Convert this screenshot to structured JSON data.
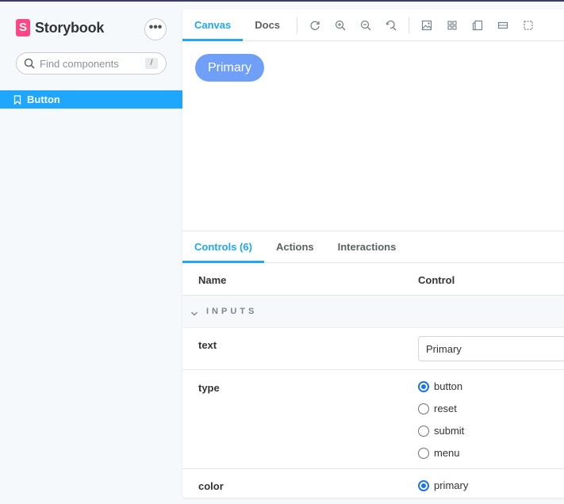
{
  "sidebar": {
    "brand_name": "Storybook",
    "brand_letter": "S",
    "menu_label": "•••",
    "search": {
      "placeholder": "Find components",
      "shortcut": "/"
    },
    "items": [
      {
        "label": "Button",
        "selected": true
      }
    ]
  },
  "toolbar": {
    "tabs": [
      {
        "label": "Canvas",
        "active": true
      },
      {
        "label": "Docs",
        "active": false
      }
    ],
    "tools": [
      "reload-icon",
      "zoom-in-icon",
      "zoom-out-icon",
      "zoom-reset-icon",
      "background-icon",
      "grid-icon",
      "viewport-icon",
      "measure-icon",
      "outline-icon"
    ]
  },
  "canvas": {
    "primary_button_label": "Primary"
  },
  "addons": {
    "tabs": [
      {
        "label": "Controls (6)",
        "active": true
      },
      {
        "label": "Actions",
        "active": false
      },
      {
        "label": "Interactions",
        "active": false
      }
    ],
    "table_headers": {
      "name": "Name",
      "control": "Control"
    },
    "section_label": "INPUTS",
    "rows": {
      "text": {
        "name": "text",
        "value": "Primary"
      },
      "type": {
        "name": "type",
        "options": [
          "button",
          "reset",
          "submit",
          "menu"
        ],
        "selected": "button"
      },
      "color": {
        "name": "color",
        "options": [
          "primary"
        ],
        "selected": "primary"
      }
    }
  },
  "colors": {
    "accent": "#1ea7fd",
    "brand": "#ff4785",
    "primary_button": "#6f9ff7",
    "radio": "#1a73e8"
  }
}
